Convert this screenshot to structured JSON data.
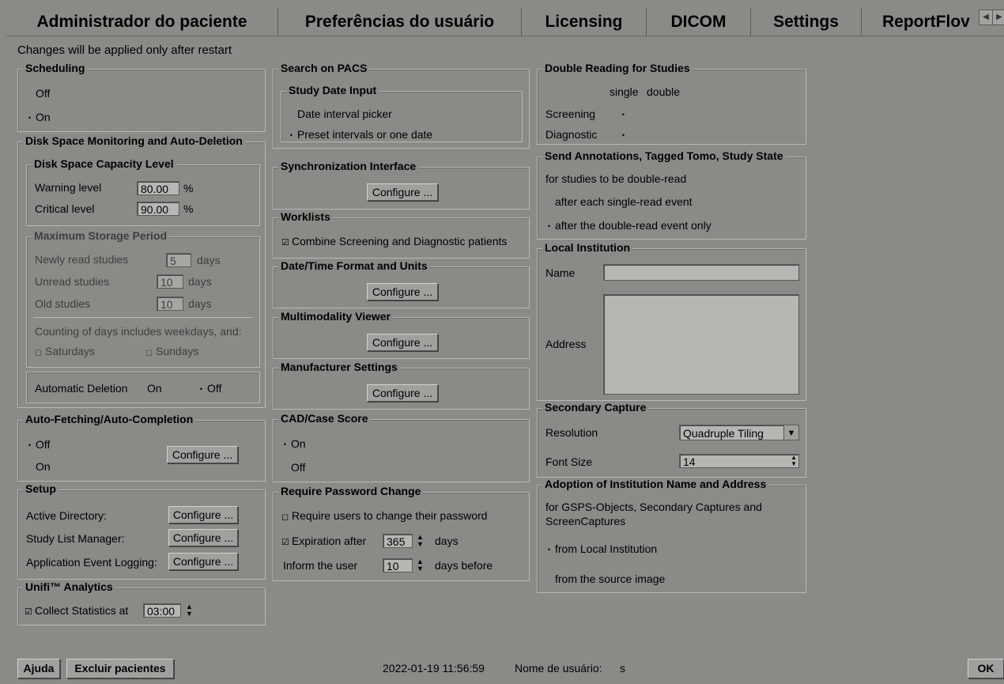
{
  "tabs": [
    "Administrador do paciente",
    "Preferências do usuário",
    "Licensing",
    "DICOM",
    "Settings",
    "ReportFlov"
  ],
  "restart_note": "Changes will be applied only after restart",
  "scheduling": {
    "title": "Scheduling",
    "off": "Off",
    "on": "On",
    "selected": "On"
  },
  "disk": {
    "title": "Disk Space Monitoring and Auto-Deletion",
    "capacity_title": "Disk Space Capacity Level",
    "warning_label": "Warning level",
    "warning_value": "80.00",
    "critical_label": "Critical level",
    "critical_value": "90.00",
    "percent": "%",
    "storage_title": "Maximum Storage Period",
    "newly_label": "Newly read studies",
    "newly_value": "5",
    "unread_label": "Unread studies",
    "unread_value": "10",
    "old_label": "Old studies",
    "old_value": "10",
    "days": "days",
    "counting_note": "Counting of days includes weekdays, and:",
    "saturdays": "Saturdays",
    "sundays": "Sundays",
    "auto_deletion_label": "Automatic Deletion",
    "auto_on": "On",
    "auto_off": "Off"
  },
  "autofetch": {
    "title": "Auto-Fetching/Auto-Completion",
    "off": "Off",
    "on": "On",
    "configure": "Configure ..."
  },
  "setup": {
    "title": "Setup",
    "items": [
      {
        "label": "Active Directory:",
        "button": "Configure ..."
      },
      {
        "label": "Study List Manager:",
        "button": "Configure ..."
      },
      {
        "label": "Application Event Logging:",
        "button": "Configure ..."
      }
    ]
  },
  "analytics": {
    "title": "Unifi™ Analytics",
    "collect_label": "Collect Statistics at",
    "time": "03:00"
  },
  "pacs": {
    "title": "Search on PACS",
    "input_title": "Study Date Input",
    "opt1": "Date interval picker",
    "opt2": "Preset intervals or one date"
  },
  "sync": {
    "title": "Synchronization Interface",
    "configure": "Configure ..."
  },
  "worklists": {
    "title": "Worklists",
    "combine": "Combine Screening and Diagnostic patients"
  },
  "datetime": {
    "title": "Date/Time Format and Units",
    "configure": "Configure ..."
  },
  "multimodality": {
    "title": "Multimodality Viewer",
    "configure": "Configure ..."
  },
  "manufacturer": {
    "title": "Manufacturer Settings",
    "configure": "Configure ..."
  },
  "cad": {
    "title": "CAD/Case Score",
    "on": "On",
    "off": "Off"
  },
  "password": {
    "title": "Require Password Change",
    "require": "Require users to change their password",
    "expiration": "Expiration after",
    "exp_value": "365",
    "days": "days",
    "inform": "Inform the user",
    "inform_value": "10",
    "days_before": "days before"
  },
  "double_reading": {
    "title": "Double Reading for Studies",
    "single": "single",
    "double": "double",
    "screening": "Screening",
    "diagnostic": "Diagnostic"
  },
  "annotations": {
    "title": "Send Annotations, Tagged Tomo, Study State",
    "note": "for studies to be double-read",
    "opt1": "after each single-read event",
    "opt2": "after the double-read event only"
  },
  "institution": {
    "title": "Local Institution",
    "name_label": "Name",
    "address_label": "Address",
    "name_value": "",
    "address_value": ""
  },
  "capture": {
    "title": "Secondary Capture",
    "resolution_label": "Resolution",
    "resolution_value": "Quadruple Tiling",
    "font_label": "Font Size",
    "font_value": "14"
  },
  "adoption": {
    "title": "Adoption of Institution Name and Address",
    "note_line1": "for GSPS-Objects, Secondary Captures and",
    "note_line2": "ScreenCaptures",
    "opt1": "from Local Institution",
    "opt2": "from the source image"
  },
  "statusbar": {
    "help": "Ajuda",
    "delete": "Excluir pacientes",
    "datetime": "2022-01-19  11:56:59",
    "user_label": "Nome de usuário:",
    "user": "s",
    "ok": "OK"
  }
}
